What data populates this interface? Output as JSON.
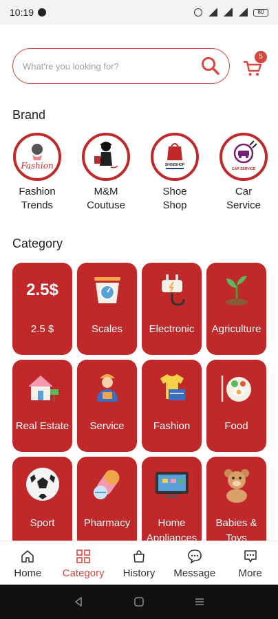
{
  "status_bar": {
    "time": "10:19",
    "battery": "80"
  },
  "search": {
    "placeholder": "What're you looking for?"
  },
  "cart": {
    "badge_count": "5"
  },
  "brand_section": {
    "title": "Brand",
    "items": [
      {
        "name_line1": "Fashion",
        "name_line2": "Trends",
        "logo_text": "Fashion"
      },
      {
        "name_line1": "M&M",
        "name_line2": "Coutuse"
      },
      {
        "name_line1": "Shoe",
        "name_line2": "Shop",
        "logo_text": "SHOESHOP"
      },
      {
        "name_line1": "Car",
        "name_line2": "Service",
        "logo_text": "CAR SERVICE"
      }
    ]
  },
  "category_section": {
    "title": "Category",
    "items": [
      {
        "label": "2.5 $",
        "icon_text": "2.5$"
      },
      {
        "label": "Scales",
        "icon": "scales-icon"
      },
      {
        "label": "Electronic",
        "icon": "plug-icon"
      },
      {
        "label": "Agriculture",
        "icon": "plant-icon"
      },
      {
        "label": "Real Estate",
        "icon": "house-icon"
      },
      {
        "label": "Service",
        "icon": "worker-icon"
      },
      {
        "label": "Fashion",
        "icon": "clothes-icon"
      },
      {
        "label": "Food",
        "icon": "plate-icon"
      },
      {
        "label": "Sport",
        "icon": "soccer-ball-icon"
      },
      {
        "label": "Pharmacy",
        "icon": "pills-icon"
      },
      {
        "label": "Home Appliances",
        "icon": "tv-icon"
      },
      {
        "label": "Babies & Toys",
        "icon": "teddy-bear-icon"
      }
    ]
  },
  "bottom_nav": {
    "items": [
      {
        "label": "Home"
      },
      {
        "label": "Category"
      },
      {
        "label": "History"
      },
      {
        "label": "Message"
      },
      {
        "label": "More"
      }
    ],
    "active": "Category"
  },
  "colors": {
    "primary": "#c0282a",
    "accent": "#d8473d"
  }
}
